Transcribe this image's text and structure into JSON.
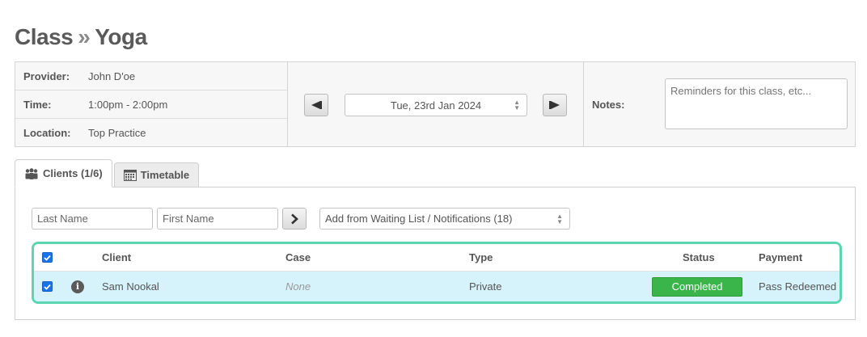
{
  "header": {
    "breadcrumb_parent": "Class",
    "breadcrumb_separator": "»",
    "title": "Yoga"
  },
  "details": {
    "provider_label": "Provider:",
    "provider_value": "John D'oe",
    "time_label": "Time:",
    "time_value": "1:00pm - 2:00pm",
    "location_label": "Location:",
    "location_value": "Top Practice"
  },
  "date_nav": {
    "selected_date": "Tue, 23rd Jan 2024",
    "prev_icon": "triangle-left-icon",
    "next_icon": "triangle-right-icon"
  },
  "notes": {
    "label": "Notes:",
    "placeholder": "Reminders for this class, etc..."
  },
  "tabs": [
    {
      "label": "Clients (1/6)",
      "icon": "people-icon",
      "active": true
    },
    {
      "label": "Timetable",
      "icon": "calendar-icon",
      "active": false
    }
  ],
  "filters": {
    "last_name_placeholder": "Last Name",
    "first_name_placeholder": "First Name",
    "waiting_list_selected": "Add from Waiting List / Notifications (18)"
  },
  "clients_table": {
    "columns": [
      "Client",
      "Case",
      "Type",
      "Status",
      "Payment"
    ],
    "rows": [
      {
        "checked": true,
        "client": "Sam Nookal",
        "case": "None",
        "type": "Private",
        "status": "Completed",
        "payment": "Pass Redeemed"
      }
    ]
  },
  "colors": {
    "highlight_border": "#5bd6b0",
    "row_background": "#d6f2fb",
    "status_completed": "#3ab54a",
    "checkbox": "#1a73e8"
  }
}
